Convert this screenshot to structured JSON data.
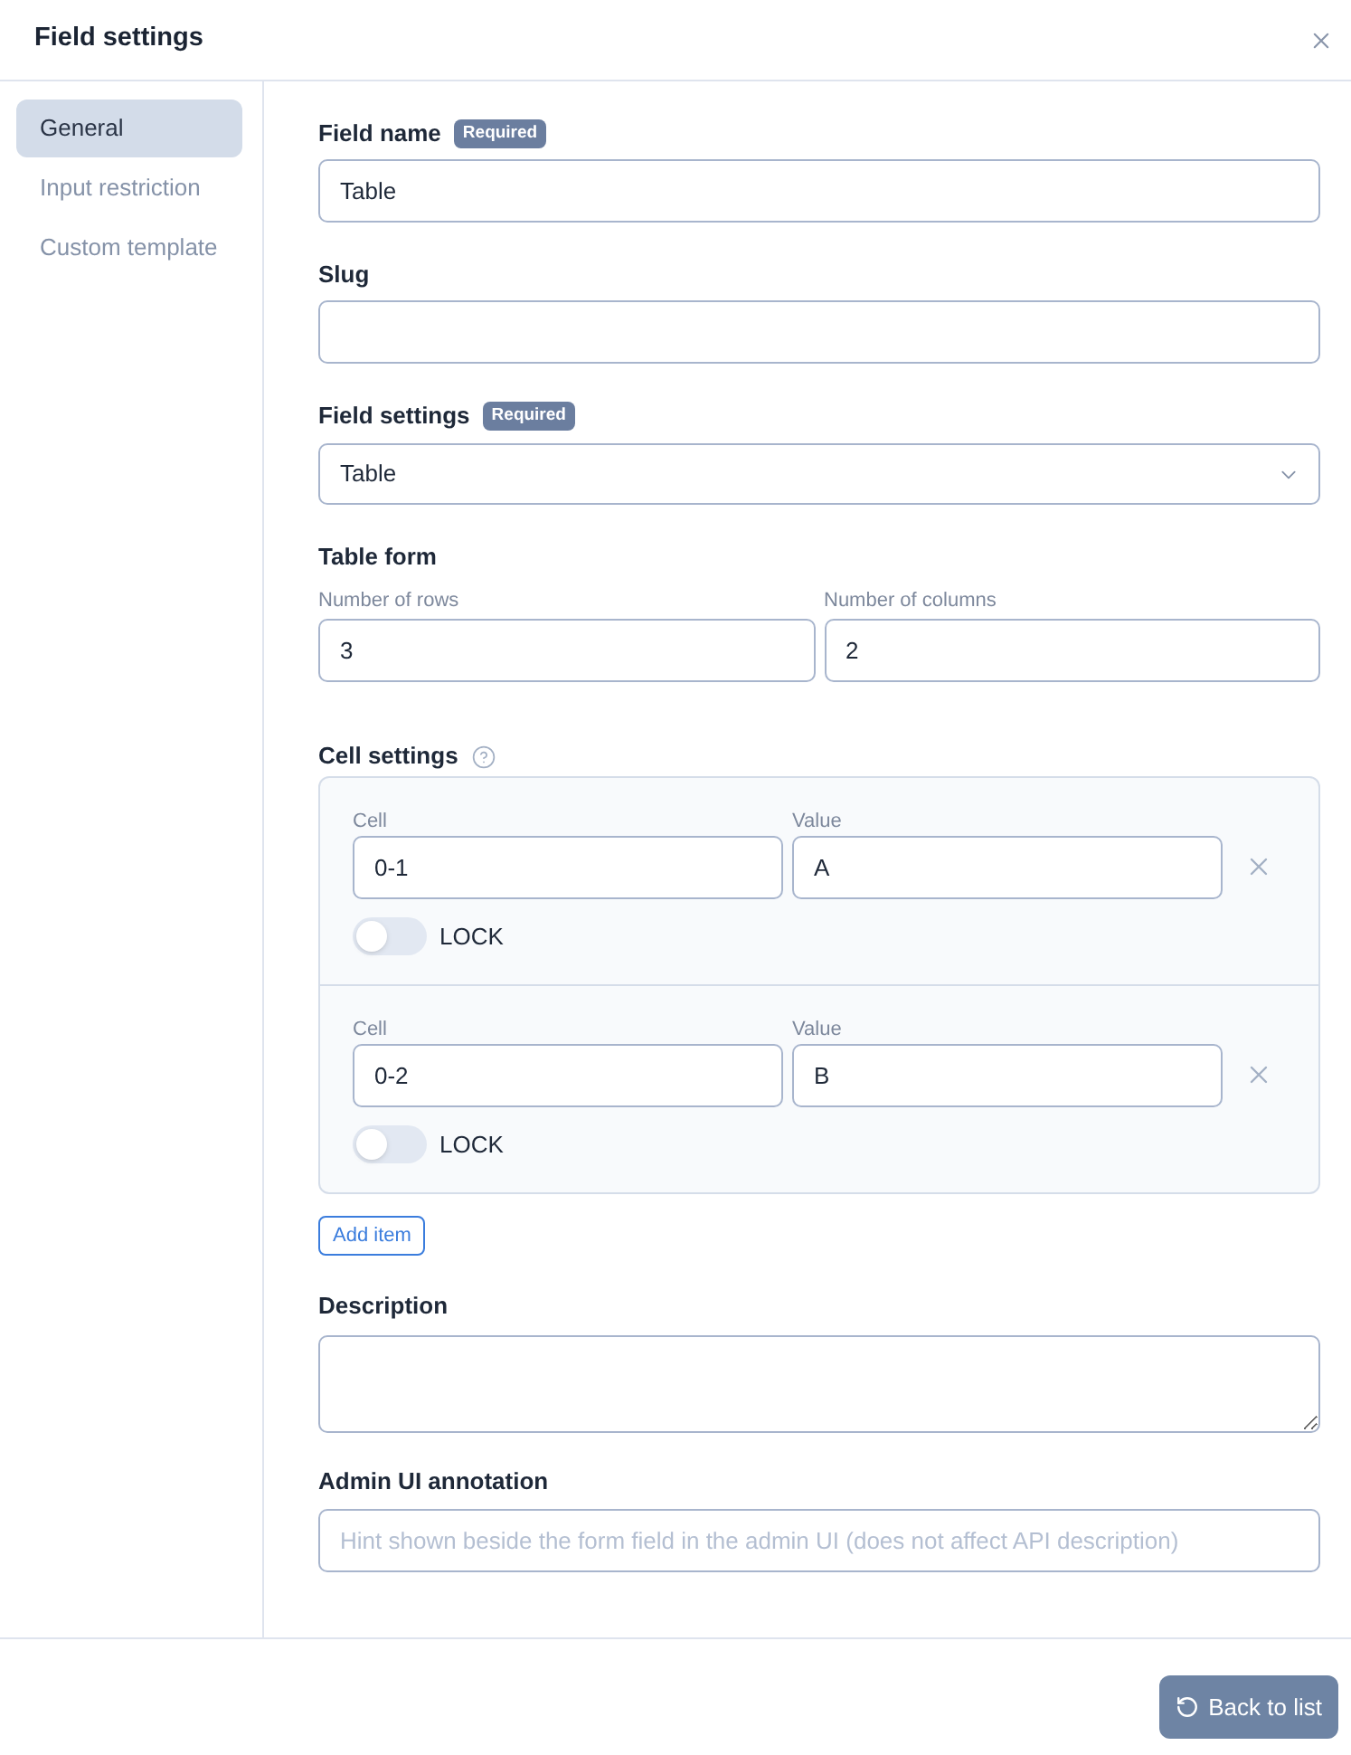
{
  "window": {
    "title": "Field settings"
  },
  "sidebar": {
    "items": [
      {
        "label": "General",
        "selected": true
      },
      {
        "label": "Input restriction",
        "selected": false
      },
      {
        "label": "Custom template",
        "selected": false
      }
    ]
  },
  "form": {
    "field_name": {
      "label": "Field name",
      "badge": "Required",
      "value": "Table"
    },
    "slug": {
      "label": "Slug"
    },
    "field_type": {
      "label": "Field settings",
      "badge": "Required",
      "value": "Table"
    },
    "table_form": {
      "label": "Table form",
      "rows": {
        "label": "Number of rows",
        "value": "3"
      },
      "columns": {
        "label": "Number of columns",
        "value": "2"
      }
    },
    "cell_settings": {
      "label": "Cell settings",
      "items": [
        {
          "cell_label": "Cell",
          "cell": "0-1",
          "value_label": "Value",
          "value": "A",
          "lock_label": "LOCK",
          "locked": false
        },
        {
          "cell_label": "Cell",
          "cell": "0-2",
          "value_label": "Value",
          "value": "B",
          "lock_label": "LOCK",
          "locked": false
        }
      ],
      "add_button": "Add item"
    },
    "description": {
      "label": "Description"
    },
    "admin_annotation": {
      "label": "Admin UI annotation",
      "placeholder": "Hint shown beside the form field in the admin UI (does not affect API description)"
    }
  },
  "footer": {
    "back_button": "Back to list"
  }
}
